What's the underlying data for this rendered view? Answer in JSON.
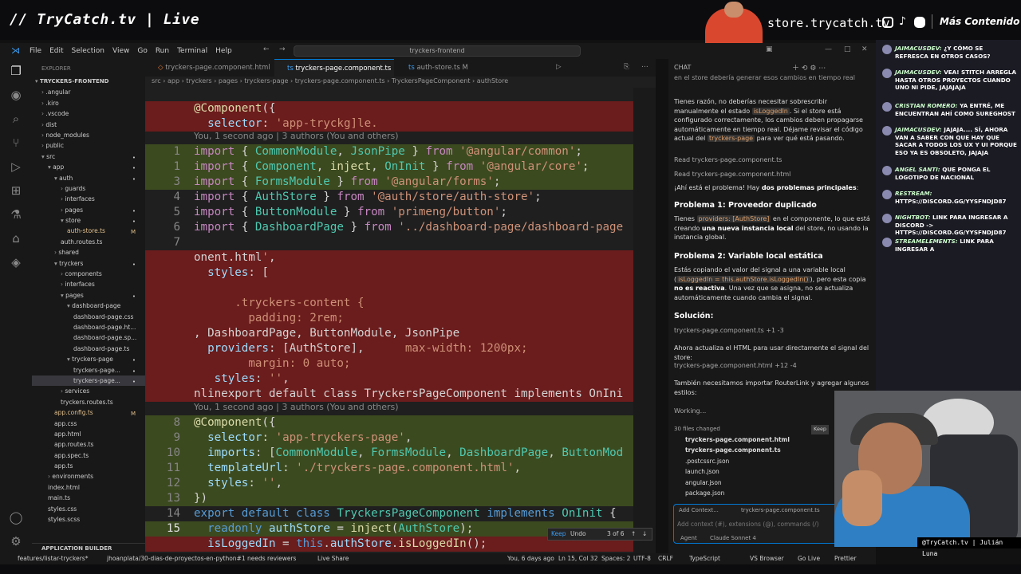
{
  "stream": {
    "brand": "// TryCatch.tv | Live",
    "store": "store.trycatch.tv",
    "mas": "Más Contenido",
    "cam_label": "@TryCatch.tv | Julián Luna"
  },
  "window": {
    "menu": [
      "File",
      "Edit",
      "Selection",
      "View",
      "Go",
      "Run",
      "Terminal",
      "Help"
    ],
    "search": "tryckers-frontend"
  },
  "explorer": {
    "title": "EXPLORER",
    "items": [
      {
        "label": "TRYCKERS-FRONTEND",
        "depth": 0,
        "icon": "▾",
        "st": ""
      },
      {
        "label": ".angular",
        "depth": 1,
        "icon": "›",
        "st": ""
      },
      {
        "label": ".kiro",
        "depth": 1,
        "icon": "›",
        "st": ""
      },
      {
        "label": ".vscode",
        "depth": 1,
        "icon": "›",
        "st": ""
      },
      {
        "label": "dist",
        "depth": 1,
        "icon": "›",
        "st": ""
      },
      {
        "label": "node_modules",
        "depth": 1,
        "icon": "›",
        "st": ""
      },
      {
        "label": "public",
        "depth": 1,
        "icon": "›",
        "st": ""
      },
      {
        "label": "src",
        "depth": 1,
        "icon": "▾",
        "st": "•"
      },
      {
        "label": "app",
        "depth": 2,
        "icon": "▾",
        "st": "•"
      },
      {
        "label": "auth",
        "depth": 3,
        "icon": "▾",
        "st": "•"
      },
      {
        "label": "guards",
        "depth": 4,
        "icon": "›",
        "st": ""
      },
      {
        "label": "interfaces",
        "depth": 4,
        "icon": "›",
        "st": ""
      },
      {
        "label": "pages",
        "depth": 4,
        "icon": "›",
        "st": "•"
      },
      {
        "label": "store",
        "depth": 4,
        "icon": "▾",
        "st": "•"
      },
      {
        "label": "auth-store.ts",
        "depth": 5,
        "icon": "",
        "st": "M"
      },
      {
        "label": "auth.routes.ts",
        "depth": 4,
        "icon": "",
        "st": ""
      },
      {
        "label": "shared",
        "depth": 3,
        "icon": "›",
        "st": ""
      },
      {
        "label": "tryckers",
        "depth": 3,
        "icon": "▾",
        "st": "•"
      },
      {
        "label": "components",
        "depth": 4,
        "icon": "›",
        "st": ""
      },
      {
        "label": "interfaces",
        "depth": 4,
        "icon": "›",
        "st": ""
      },
      {
        "label": "pages",
        "depth": 4,
        "icon": "▾",
        "st": "•"
      },
      {
        "label": "dashboard-page",
        "depth": 5,
        "icon": "▾",
        "st": ""
      },
      {
        "label": "dashboard-page.css",
        "depth": 6,
        "icon": "",
        "st": ""
      },
      {
        "label": "dashboard-page.ht...",
        "depth": 6,
        "icon": "",
        "st": ""
      },
      {
        "label": "dashboard-page.sp...",
        "depth": 6,
        "icon": "",
        "st": ""
      },
      {
        "label": "dashboard-page.ts",
        "depth": 6,
        "icon": "",
        "st": ""
      },
      {
        "label": "tryckers-page",
        "depth": 5,
        "icon": "▾",
        "st": "•"
      },
      {
        "label": "tryckers-page...",
        "depth": 6,
        "icon": "",
        "st": "•"
      },
      {
        "label": "tryckers-page...",
        "depth": 6,
        "icon": "",
        "st": "•"
      },
      {
        "label": "services",
        "depth": 4,
        "icon": "›",
        "st": ""
      },
      {
        "label": "tryckers.routes.ts",
        "depth": 4,
        "icon": "",
        "st": ""
      },
      {
        "label": "app.config.ts",
        "depth": 3,
        "icon": "",
        "st": "M"
      },
      {
        "label": "app.css",
        "depth": 3,
        "icon": "",
        "st": ""
      },
      {
        "label": "app.html",
        "depth": 3,
        "icon": "",
        "st": ""
      },
      {
        "label": "app.routes.ts",
        "depth": 3,
        "icon": "",
        "st": ""
      },
      {
        "label": "app.spec.ts",
        "depth": 3,
        "icon": "",
        "st": ""
      },
      {
        "label": "app.ts",
        "depth": 3,
        "icon": "",
        "st": ""
      },
      {
        "label": "environments",
        "depth": 2,
        "icon": "›",
        "st": ""
      },
      {
        "label": "index.html",
        "depth": 2,
        "icon": "",
        "st": ""
      },
      {
        "label": "main.ts",
        "depth": 2,
        "icon": "",
        "st": ""
      },
      {
        "label": "styles.css",
        "depth": 2,
        "icon": "",
        "st": ""
      },
      {
        "label": "styles.scss",
        "depth": 2,
        "icon": "",
        "st": ""
      }
    ],
    "app_builder": "APPLICATION BUILDER"
  },
  "tabs": [
    {
      "label": "tryckers-page.component.html"
    },
    {
      "label": "tryckers-page.component.ts"
    },
    {
      "label": "auth-store.ts M"
    }
  ],
  "breadcrumb": "src › app › tryckers › pages › tryckers-page › tryckers-page.component.ts › TryckersPageComponent › authStore",
  "code": {
    "blame1": "You, 1 second ago | 3 authors (You and others)",
    "blame2": "You, 1 second ago | 3 authors (You and others)"
  },
  "inline_bar": {
    "keep": "Keep",
    "undo": "Undo",
    "count": "3 of 6"
  },
  "chat": {
    "title": "CHAT",
    "p0": "en el store debería generar esos cambios en tiempo real",
    "p1a": "Tienes razón, no deberías necesitar sobrescribir manualmente el estado ",
    "p1b": "isLoggedIn",
    "p1c": ". Si el store está configurado correctamente, los cambios deben propagarse automáticamente en tiempo real. Déjame revisar el código actual del ",
    "p1d": "tryckers-page",
    "p1e": " para ver qué está pasando.",
    "read1": "Read  tryckers-page.component.ts",
    "read2": "Read  tryckers-page.component.html",
    "p2a": "¡Ahí está el problema! Hay ",
    "p2b": "dos problemas principales",
    "p2c": ":",
    "h1": "Problema 1: Proveedor duplicado",
    "p3a": "Tienes ",
    "p3b": "providers: [AuthStore]",
    "p3c": " en el componente, lo que está creando ",
    "p3d": "una nueva instancia local",
    "p3e": " del store, no usando la instancia global.",
    "h2": "Problema 2: Variable local estática",
    "p4a": "Estás copiando el valor del signal a una variable local (",
    "p4b": "isLoggedIn = this.authStore.isLoggedIn()",
    "p4c": "), pero esta copia ",
    "p4d": "no es reactiva",
    "p4e": ". Una vez que se asigna, no se actualiza automáticamente cuando cambia el signal.",
    "h3": "Solución:",
    "file1": "tryckers-page.component.ts +1 -3",
    "p5": "Ahora actualiza el HTML para usar directamente el signal del store:",
    "file2": "tryckers-page.component.html +12 -4",
    "p6": "También necesitamos importar RouterLink y agregar algunos estilos:",
    "working": "Working...",
    "changed": "30 files changed",
    "keep": "Keep",
    "files": [
      "tryckers-page.component.html",
      "tryckers-page.component.ts",
      ".postcssrc.json",
      "launch.json",
      "angular.json",
      "package.json"
    ],
    "addctx": "Add Context...",
    "ctxfile": "tryckers-page.component.ts",
    "placeholder": "Add context (#), extensions (@), commands (/)",
    "agent": "Agent",
    "model": "Claude Sonnet 4"
  },
  "status": {
    "branch": "features/listar-tryckers*",
    "pr": "jhoanplata/30-dias-de-proyectos-en-python#1 needs reviewers",
    "live": "Live Share",
    "blame": "You, 6 days ago",
    "pos": "Ln 15, Col 32",
    "spaces": "Spaces: 2",
    "enc": "UTF-8",
    "eol": "CRLF",
    "lang": "TypeScript",
    "browser": "VS Browser",
    "golive": "Go Live",
    "prettier": "Prettier"
  },
  "stream_chat": [
    {
      "user": "JAIMACUSDEV:",
      "text": "¿Y CÓMO SE REFRESCA EN OTROS CASOS?"
    },
    {
      "user": "JAIMACUSDEV:",
      "text": "VEA! STITCH ARREGLA HASTA OTROS PROYECTOS CUANDO UNO NI PIDE, JAJAJAJA"
    },
    {
      "user": "CRISTIAN ROMERO:",
      "text": "YA ENTRÉ, ME ENCUENTRAN AHÍ COMO SUREGHOST"
    },
    {
      "user": "JAIMACUSDEV:",
      "text": "JAJAJA.... SÍ, AHORA VAN A SABER CON QUE HAY QUE SACAR A TODOS LOS UX Y UI PORQUE ESO YA ES OBSOLETO, JAJAJA"
    },
    {
      "user": "ANGEL SANTI:",
      "text": "QUE PONGA EL LOGOTIPO DE NACIONAL"
    },
    {
      "user": "RESTREAM:",
      "text": "HTTPS://DISCORD.GG/YYSFNDJD87"
    },
    {
      "user": "NIGHTBOT:",
      "text": "LINK PARA INGRESAR A DISCORD -> HTTPS://DISCORD.GG/YYSFNDJD87"
    },
    {
      "user": "STREAMELEMENTS:",
      "text": "LINK PARA INGRESAR A"
    }
  ]
}
